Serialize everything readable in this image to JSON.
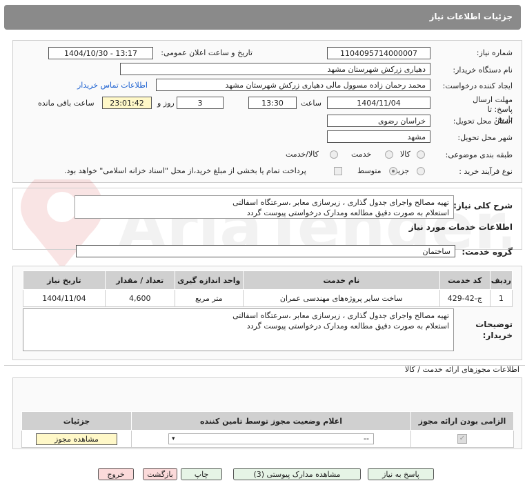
{
  "page": {
    "title": "جزئیات اطلاعات نیاز"
  },
  "form": {
    "need_number_label": "شماره نیاز:",
    "need_number": "1104095714000007",
    "announce_label": "تاریخ و ساعت اعلان عمومی:",
    "announce_value": "1404/10/30 - 13:17",
    "buyer_org_label": "نام دستگاه خریدار:",
    "buyer_org": "دهیاری زرکش  شهرستان مشهد",
    "creator_label": "ایجاد کننده درخواست:",
    "creator": "محمد رحمان زاده مسوول مالی  دهیاری زرکش  شهرستان مشهد",
    "contact_link": "اطلاعات تماس خریدار",
    "deadline_label": "مهلت ارسال پاسخ: تا تاریخ:",
    "deadline_date": "1404/11/04",
    "time_label": "ساعت",
    "deadline_time": "13:30",
    "days_label": "روز و",
    "days": "3",
    "remaining_time": "23:01:42",
    "remaining_label": "ساعت باقی مانده",
    "province_label": "استان محل تحویل:",
    "province": "خراسان رضوی",
    "city_label": "شهر محل تحویل:",
    "city": "مشهد",
    "category_label": "طبقه بندی موضوعی:",
    "category_options": [
      "کالا",
      "خدمت",
      "کالا/خدمت"
    ],
    "process_label": "نوع فرآیند خرید :",
    "process_options": [
      "جزیی",
      "متوسط"
    ],
    "payment_text": "پرداخت تمام یا بخشی از مبلغ خرید،از محل \"اسناد خزانه اسلامی\" خواهد بود."
  },
  "description": {
    "label": "شرح کلی نیاز:",
    "text_line1": "تهیه مصالح واجرای جدول گذاری ، زیرسازی معابر ،سرعتگاه اسفالتی",
    "text_line2": "استعلام به صورت دقیق مطالعه ومدارک درخواستی پیوست گردد"
  },
  "services": {
    "section_title": "اطلاعات خدمات مورد نیاز",
    "group_label": "گروه خدمت:",
    "group_value": "ساختمان",
    "headers": [
      "ردیف",
      "کد خدمت",
      "نام خدمت",
      "واحد اندازه گیری",
      "تعداد / مقدار",
      "تاریخ نیاز"
    ],
    "rows": [
      {
        "row": "1",
        "code": "ج-42-429",
        "name": "ساخت سایر پروژه‌های مهندسی عمران",
        "unit": "متر مربع",
        "qty": "4,600",
        "date": "1404/11/04"
      }
    ],
    "buyer_notes_label": "توضیحات خریدار:",
    "buyer_notes_line1": "تهیه مصالح واجرای جدول گذاری ، زیرسازی معابر ،سرعتگاه اسفالتی",
    "buyer_notes_line2": "استعلام به صورت دقیق مطالعه ومدارک درخواستی پیوست گردد"
  },
  "permits": {
    "section_title": "اطلاعات مجوزهای ارائه خدمت / کالا",
    "headers": [
      "الزامی بودن ارائه مجوز",
      "اعلام وضعیت مجوز توسط تامین کننده",
      "جزئیات"
    ],
    "select_value": "--",
    "view_button": "مشاهده مجوز"
  },
  "buttons": {
    "reply": "پاسخ به نیاز",
    "attachments": "مشاهده مدارک پیوستی (3)",
    "print": "چاپ",
    "back": "بازگشت",
    "exit": "خروج"
  },
  "watermark": {
    "text": "AriaTender.neT"
  },
  "colors": {
    "title_bg": "#8a8a8a",
    "highlight": "#fff8c8",
    "green_btn": "#e6f4e6",
    "pink_btn": "#fbdada",
    "link": "#1a5fd0"
  }
}
